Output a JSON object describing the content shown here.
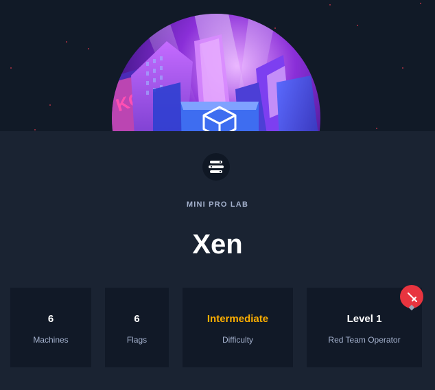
{
  "lab": {
    "type_label": "MINI PRO LAB",
    "title": "Xen",
    "icon": "prolab-logo-icon",
    "art": "city-skyline-artwork"
  },
  "stats": [
    {
      "value": "6",
      "label": "Machines"
    },
    {
      "value": "6",
      "label": "Flags"
    },
    {
      "value": "Intermediate",
      "label": "Difficulty"
    },
    {
      "value": "Level 1",
      "label": "Red Team Operator"
    }
  ],
  "badge": {
    "icon": "red-team-sword-icon"
  },
  "colors": {
    "background": "#1a2332",
    "hero_background": "#111a27",
    "card_background": "#111927",
    "label": "#a4b1cd",
    "difficulty": "#ffaf00",
    "badge": "#e8343f"
  }
}
